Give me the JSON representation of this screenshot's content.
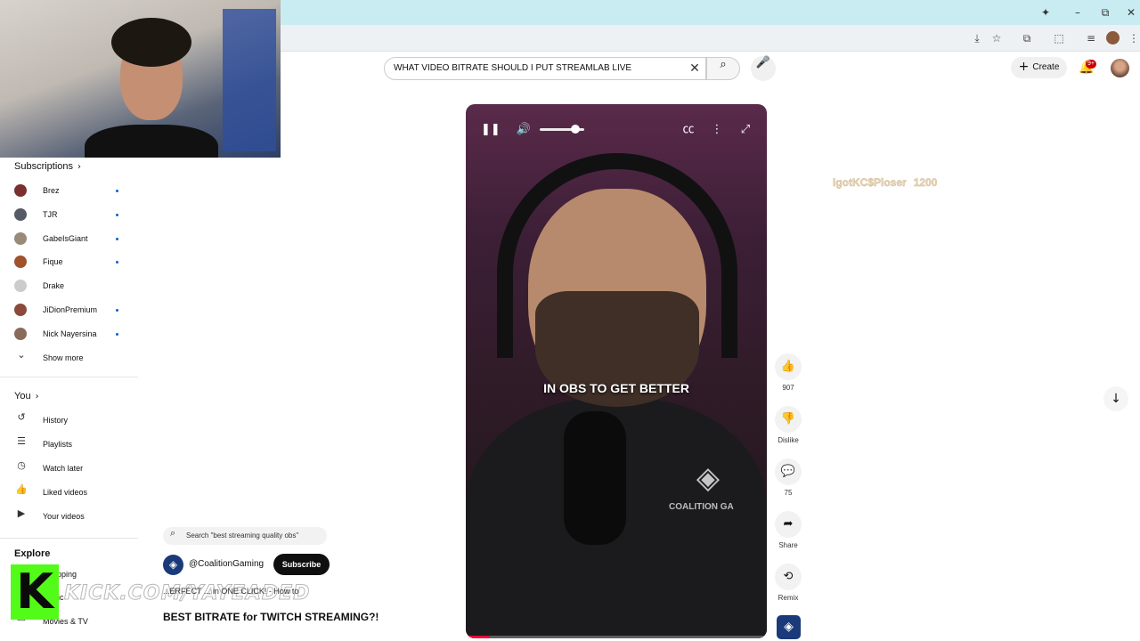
{
  "browser": {
    "minimize": "–",
    "restore": "⧉",
    "close": "✕",
    "addressbar_icons": [
      "⤓",
      "☆",
      "⬚",
      "≡",
      "⋮"
    ]
  },
  "search": {
    "query": "WHAT VIDEO BITRATE SHOULD I PUT STREAMLAB LIVE",
    "clear": "✕",
    "search_icon": "⌕",
    "mic_icon": "🎙"
  },
  "header": {
    "create_label": "Create",
    "notifications_badge": "9+"
  },
  "sidebar": {
    "subscriptions_title": "Subscriptions",
    "subscriptions": [
      {
        "name": "Brez",
        "color": "#7a3030"
      },
      {
        "name": "TJR",
        "color": "#555a66"
      },
      {
        "name": "GabeIsGiant",
        "color": "#9a8a7a"
      },
      {
        "name": "Fique",
        "color": "#a0522d"
      },
      {
        "name": "Drake",
        "color": "#cccccc"
      },
      {
        "name": "JiDionPremium",
        "color": "#8b4a3a"
      },
      {
        "name": "Nick Nayersina",
        "color": "#8a6a5a"
      }
    ],
    "show_more": "Show more",
    "you_title": "You",
    "you_items": [
      "History",
      "Playlists",
      "Watch later",
      "Liked videos",
      "Your videos"
    ],
    "explore_title": "Explore",
    "explore_items": [
      "Shopping",
      "Music",
      "Movies & TV"
    ]
  },
  "overlay": {
    "kick_letter": "K",
    "kick_url": "KICK.COM/YAYEADED"
  },
  "short": {
    "related_search": "Search \"best streaming quality obs\"",
    "channel": "@CoalitionGaming",
    "subscribe": "Subscribe",
    "subtitle": "...ERFECT ... in ONE CLICK! - How to",
    "title": "BEST BITRATE for TWITCH STREAMING?!",
    "caption": "IN OBS TO GET BETTER",
    "watermark": "COALITION GA",
    "volume_level": 0.8,
    "progress": 0.08
  },
  "actions": {
    "likes": "907",
    "dislike": "Dislike",
    "comments": "75",
    "share": "Share",
    "remix": "Remix"
  },
  "stream_alert": {
    "user": "IgotKC$Ploser",
    "amount": "1200"
  },
  "colors": {
    "accent_red": "#ff0033",
    "kick_green": "#53fc18",
    "link_blue": "#065fd4"
  }
}
